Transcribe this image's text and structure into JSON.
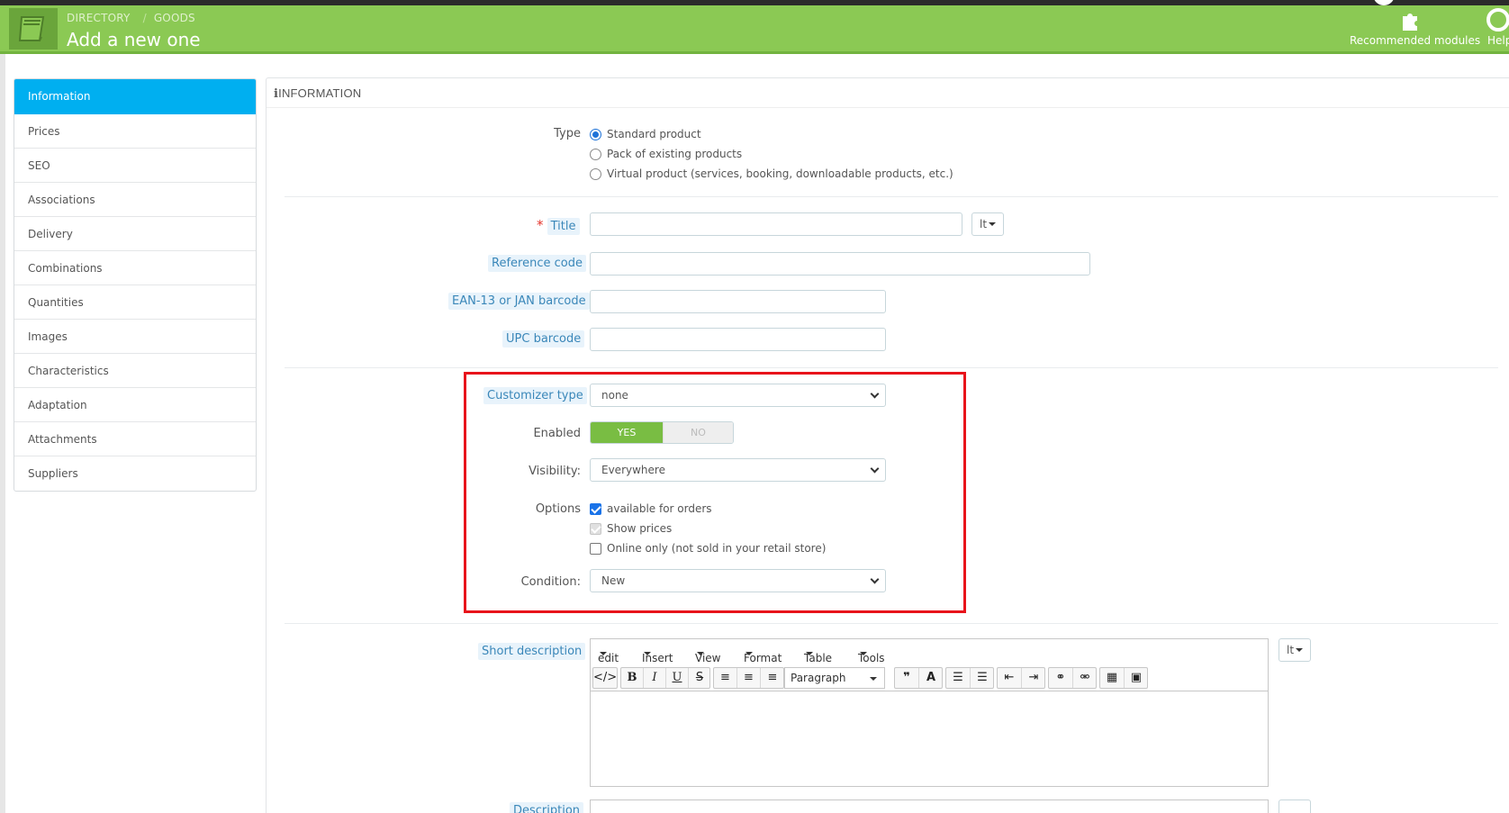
{
  "header": {
    "breadcrumb": [
      "DIRECTORY",
      "GOODS"
    ],
    "title": "Add a new one",
    "recommended_label": "Recommended modules",
    "help_label": "Help",
    "bg_color": "#8bc954"
  },
  "sidebar": {
    "items": [
      {
        "label": "Information",
        "active": true
      },
      {
        "label": "Prices"
      },
      {
        "label": "SEO"
      },
      {
        "label": "Associations"
      },
      {
        "label": "Delivery"
      },
      {
        "label": "Combinations"
      },
      {
        "label": "Quantities"
      },
      {
        "label": "Images"
      },
      {
        "label": "Characteristics"
      },
      {
        "label": "Adaptation"
      },
      {
        "label": "Attachments"
      },
      {
        "label": "Suppliers"
      }
    ],
    "active_color": "#00aff0"
  },
  "panel": {
    "heading": "INFORMATION",
    "type": {
      "label": "Type",
      "options": [
        "Standard product",
        "Pack of existing products",
        "Virtual product (services, booking, downloadable products, etc.)"
      ],
      "selected": "Standard product"
    },
    "title_field": {
      "label": "Title",
      "value": "",
      "lang": "lt"
    },
    "reference": {
      "label": "Reference code",
      "value": ""
    },
    "ean": {
      "label": "EAN-13 or JAN barcode",
      "value": ""
    },
    "upc": {
      "label": "UPC barcode",
      "value": ""
    },
    "customizer": {
      "label": "Customizer type",
      "value": "none"
    },
    "enabled": {
      "label": "Enabled",
      "yes": "YES",
      "no": "NO",
      "value": true
    },
    "visibility": {
      "label": "Visibility:",
      "value": "Everywhere"
    },
    "options": {
      "label": "Options",
      "items": [
        {
          "label": "available for orders",
          "checked": true
        },
        {
          "label": "Show prices",
          "checked": true,
          "disabled": true
        },
        {
          "label": "Online only (not sold in your retail store)",
          "checked": false
        }
      ]
    },
    "condition": {
      "label": "Condition:",
      "value": "New"
    },
    "short_description": {
      "label": "Short description",
      "lang": "lt",
      "menus": [
        "edit",
        "Insert",
        "View",
        "Format",
        "Table",
        "Tools"
      ],
      "paragraph": "Paragraph"
    },
    "description": {
      "label": "Description"
    }
  }
}
